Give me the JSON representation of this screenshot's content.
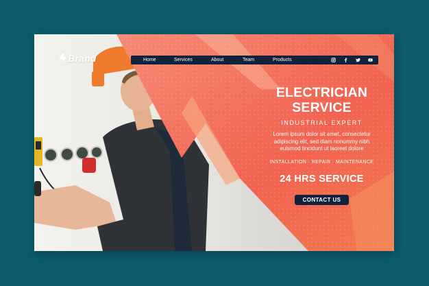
{
  "brand": {
    "name": "Brand",
    "icon": "lightning-bolt-icon"
  },
  "nav": {
    "items": [
      {
        "label": "Home"
      },
      {
        "label": "Services"
      },
      {
        "label": "About"
      },
      {
        "label": "Team"
      },
      {
        "label": "Products"
      }
    ],
    "social": [
      "instagram-icon",
      "facebook-icon",
      "twitter-icon",
      "youtube-icon"
    ]
  },
  "hero": {
    "title_line1": "ELECTRICIAN",
    "title_line2": "SERVICE",
    "subtitle": "INDUSTRIAL EXPERT",
    "body_line1": "Lorem ipsum dolor sit amet, consectetur",
    "body_line2": "adipiscing elit, sed diam nonummy nibh",
    "body_line3": "euismod tincidunt ut laoreet dolore",
    "services": "INSTALLATION · REPAIR · MAINTENANCE",
    "availability": "24 HRS SERVICE",
    "cta_label": "CONTACT US"
  },
  "colors": {
    "page_background": "#0c5c6c",
    "accent_red": "#f0584a",
    "accent_orange": "#f49a6e",
    "nav_navy": "#12223c",
    "text_white": "#ffffff"
  }
}
